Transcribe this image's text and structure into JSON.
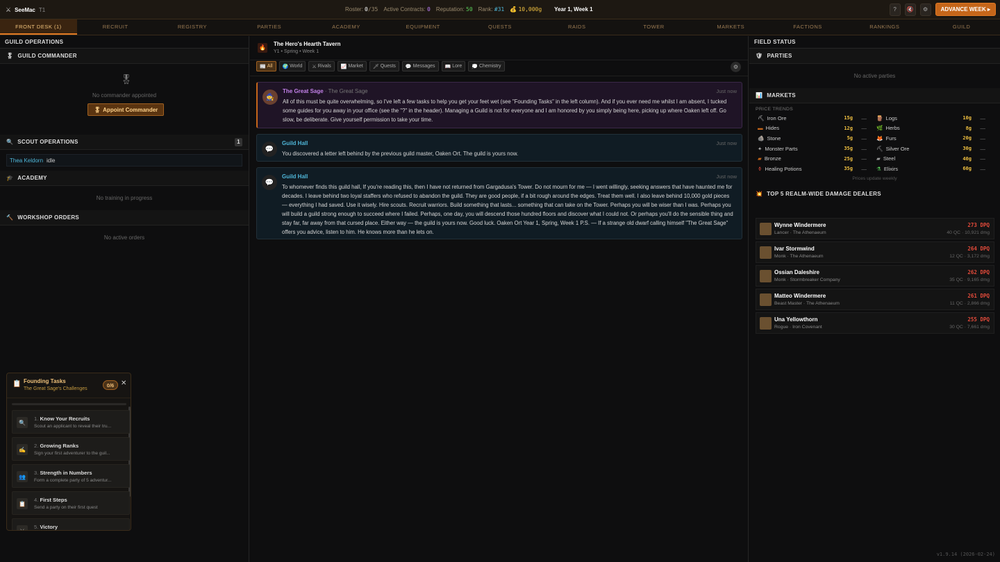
{
  "topbar": {
    "app_name": "SeeMac",
    "tier": "T1",
    "roster_label": "Roster:",
    "roster_value": "0",
    "roster_max": "/35",
    "contracts_label": "Active Contracts:",
    "contracts_value": "0",
    "reputation_label": "Reputation:",
    "reputation_value": "50",
    "rank_label": "Rank:",
    "rank_value": "#31",
    "gold": "10,000g",
    "date": "Year 1, Week 1",
    "help": "?",
    "advance_label": "ADVANCE WEEK ▸"
  },
  "tabs": [
    "FRONT DESK (1)",
    "RECRUIT",
    "REGISTRY",
    "PARTIES",
    "ACADEMY",
    "EQUIPMENT",
    "QUESTS",
    "RAIDS",
    "TOWER",
    "MARKETS",
    "FACTIONS",
    "RANKINGS",
    "GUILD"
  ],
  "left": {
    "title": "GUILD OPERATIONS",
    "commander_title": "GUILD COMMANDER",
    "no_commander": "No commander appointed",
    "appoint": "Appoint Commander",
    "scout_title": "SCOUT OPERATIONS",
    "scout_count": "1",
    "scout_name": "Thea Keldorn",
    "scout_status": "idle",
    "academy_title": "ACADEMY",
    "academy_empty": "No training in progress",
    "workshop_title": "WORKSHOP ORDERS",
    "workshop_empty": "No active orders"
  },
  "center": {
    "tavern_title": "The Hero's Hearth Tavern",
    "tavern_sub": "Y1 • Spring • Week 1",
    "filters": [
      "All",
      "World",
      "Rivals",
      "Market",
      "Quests",
      "Messages",
      "Lore",
      "Chemistry"
    ],
    "messages": [
      {
        "sender": "The Great Sage",
        "role": "· The Great Sage",
        "time": "Just now",
        "body": "All of this must be quite overwhelming, so I've left a few tasks to help you get your feet wet (see \"Founding Tasks\" in the left column). And if you ever need me whilst I am absent, I tucked some guides for you away in your office (see the \"?\" in the header). Managing a Guild is not for everyone and I am honored by you simply being here, picking up where Oaken left off. Go slow, be deliberate. Give yourself permission to take your time."
      },
      {
        "sender": "Guild Hall",
        "time": "Just now",
        "body": "You discovered a letter left behind by the previous guild master, Oaken Ort. The guild is yours now."
      },
      {
        "sender": "Guild Hall",
        "time": "Just now",
        "body": "To whomever finds this guild hall, If you're reading this, then I have not returned from Gargadusa's Tower. Do not mourn for me — I went willingly, seeking answers that have haunted me for decades. I leave behind two loyal staffers who refused to abandon the guild. They are good people, if a bit rough around the edges. Treat them well. I also leave behind 10,000 gold pieces — everything I had saved. Use it wisely. Hire scouts. Recruit warriors. Build something that lasts... something that can take on the Tower. Perhaps you will be wiser than I was. Perhaps you will build a guild strong enough to succeed where I failed. Perhaps, one day, you will descend those hundred floors and discover what I could not. Or perhaps you'll do the sensible thing and stay far, far away from that cursed place. Either way — the guild is yours now. Good luck. Oaken Ort Year 1, Spring, Week 1 P.S. — If a strange old dwarf calling himself \"The Great Sage\" offers you advice, listen to him. He knows more than he lets on."
      }
    ]
  },
  "right": {
    "title": "FIELD STATUS",
    "parties_title": "PARTIES",
    "parties_empty": "No active parties",
    "markets_title": "MARKETS",
    "price_trends": "PRICE TRENDS",
    "market_left": [
      {
        "name": "Iron Ore",
        "price": "15g",
        "trend": "—"
      },
      {
        "name": "Hides",
        "price": "12g",
        "trend": "—"
      },
      {
        "name": "Stone",
        "price": "5g",
        "trend": "—"
      },
      {
        "name": "Monster Parts",
        "price": "35g",
        "trend": "—"
      },
      {
        "name": "Bronze",
        "price": "25g",
        "trend": "—"
      },
      {
        "name": "Healing Potions",
        "price": "35g",
        "trend": "—"
      }
    ],
    "market_right": [
      {
        "name": "Logs",
        "price": "10g",
        "trend": "—"
      },
      {
        "name": "Herbs",
        "price": "8g",
        "trend": "—"
      },
      {
        "name": "Furs",
        "price": "20g",
        "trend": "—"
      },
      {
        "name": "Silver Ore",
        "price": "30g",
        "trend": "—"
      },
      {
        "name": "Steel",
        "price": "40g",
        "trend": "—"
      },
      {
        "name": "Elixirs",
        "price": "60g",
        "trend": "—"
      }
    ],
    "prices_note": "Prices update weekly",
    "dealers_title": "TOP 5 REALM-WIDE DAMAGE DEALERS",
    "dealers": [
      {
        "name": "Wynne Windermere",
        "sub": "Lancer · The Athenaeum",
        "dpq": "273 DPQ",
        "qc": "40 QC · 10,921 dmg"
      },
      {
        "name": "Ivar Stormwind",
        "sub": "Monk · The Athenaeum",
        "dpq": "264 DPQ",
        "qc": "12 QC · 3,172 dmg"
      },
      {
        "name": "Ossian Daleshire",
        "sub": "Monk · Stormbreaker Company",
        "dpq": "262 DPQ",
        "qc": "35 QC · 9,165 dmg"
      },
      {
        "name": "Matteo Windermere",
        "sub": "Beast Master · The Athenaeum",
        "dpq": "261 DPQ",
        "qc": "11 QC · 2,866 dmg"
      },
      {
        "name": "Una Yellowthorn",
        "sub": "Rogue · Iron Covenant",
        "dpq": "255 DPQ",
        "qc": "30 QC · 7,661 dmg"
      }
    ]
  },
  "founding": {
    "title": "Founding Tasks",
    "subtitle": "The Great Sage's Challenges",
    "progress": "0/6",
    "close": "✕",
    "tasks": [
      {
        "num": "1.",
        "title": "Know Your Recruits",
        "desc": "Scout an applicant to reveal their tru...",
        "icon": "🔍"
      },
      {
        "num": "2.",
        "title": "Growing Ranks",
        "desc": "Sign your first adventurer to the guil...",
        "icon": "✍"
      },
      {
        "num": "3.",
        "title": "Strength in Numbers",
        "desc": "Form a complete party of 5 adventur...",
        "icon": "👥"
      },
      {
        "num": "4.",
        "title": "First Steps",
        "desc": "Send a party on their first quest",
        "icon": "📋"
      },
      {
        "num": "5.",
        "title": "Victory",
        "desc": "",
        "icon": "⚔"
      }
    ]
  },
  "version": "v1.9.14 (2026-02-24)"
}
